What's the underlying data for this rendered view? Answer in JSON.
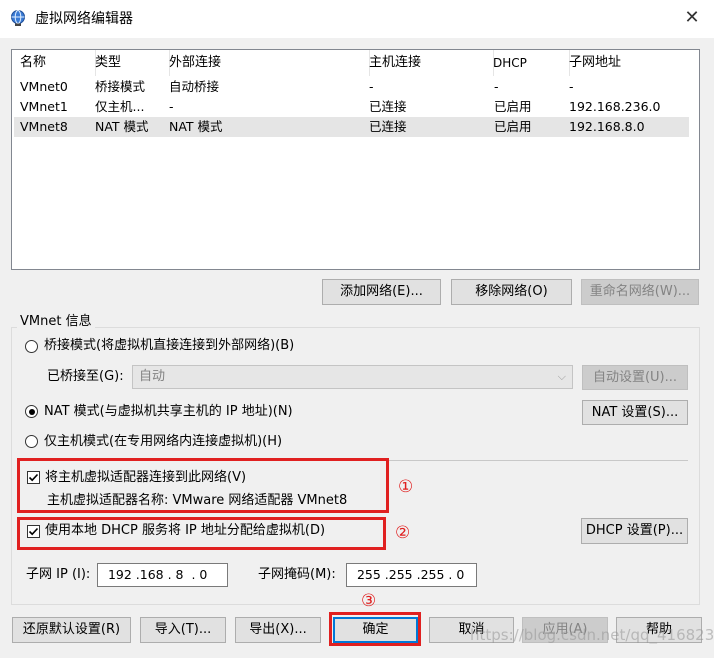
{
  "window": {
    "title": "虚拟网络编辑器",
    "close_glyph": "✕"
  },
  "network_table": {
    "columns": [
      "名称",
      "类型",
      "外部连接",
      "主机连接",
      "DHCP",
      "子网地址"
    ],
    "rows": [
      {
        "name": "VMnet0",
        "type": "桥接模式",
        "external": "自动桥接",
        "host": "-",
        "dhcp": "-",
        "subnet": "-"
      },
      {
        "name": "VMnet1",
        "type": "仅主机...",
        "external": "-",
        "host": "已连接",
        "dhcp": "已启用",
        "subnet": "192.168.236.0"
      },
      {
        "name": "VMnet8",
        "type": "NAT 模式",
        "external": "NAT 模式",
        "host": "已连接",
        "dhcp": "已启用",
        "subnet": "192.168.8.0"
      }
    ]
  },
  "table_buttons": {
    "add": "添加网络(E)...",
    "remove": "移除网络(O)",
    "rename": "重命名网络(W)..."
  },
  "vmnet_info": {
    "title": "VMnet 信息",
    "bridge_radio": "桥接模式(将虚拟机直接连接到外部网络)(B)",
    "bridged_to_label": "已桥接至(G):",
    "bridged_to_value": "自动",
    "auto_settings": "自动设置(U)...",
    "nat_radio": "NAT 模式(与虚拟机共享主机的 IP 地址)(N)",
    "nat_settings": "NAT 设置(S)...",
    "hostonly_radio": "仅主机模式(在专用网络内连接虚拟机)(H)",
    "connect_adapter": "将主机虚拟适配器连接到此网络(V)",
    "adapter_name": "主机虚拟适配器名称: VMware 网络适配器 VMnet8",
    "use_dhcp": "使用本地 DHCP 服务将 IP 地址分配给虚拟机(D)",
    "dhcp_settings": "DHCP 设置(P)...",
    "subnet_ip_label": "子网 IP (I):",
    "subnet_ip_value": " 192 .168 . 8  . 0",
    "subnet_mask_label": "子网掩码(M):",
    "subnet_mask_value": " 255 .255 .255 . 0"
  },
  "annotations": {
    "one": "①",
    "two": "②",
    "three": "③"
  },
  "bottom_buttons": {
    "restore": "还原默认设置(R)",
    "import": "导入(T)...",
    "export": "导出(X)...",
    "ok": "确定",
    "cancel": "取消",
    "apply": "应用(A)",
    "help": "帮助"
  },
  "watermark": "https://blog.csdn.net/qq_41682356",
  "colors": {
    "highlight_red": "#e02020",
    "selected_row": "#e5e5e5",
    "default_button_border": "#0078d7"
  }
}
